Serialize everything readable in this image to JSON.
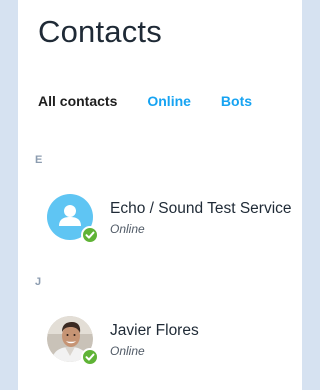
{
  "page": {
    "title": "Contacts"
  },
  "tabs": [
    {
      "label": "All contacts",
      "active": true
    },
    {
      "label": "Online",
      "active": false
    },
    {
      "label": "Bots",
      "active": false
    }
  ],
  "sections": [
    {
      "letter": "E",
      "contacts": [
        {
          "name": "Echo / Sound Test Service",
          "presence": "Online",
          "avatar_icon": "person-silhouette-icon"
        }
      ]
    },
    {
      "letter": "J",
      "contacts": [
        {
          "name": "Javier Flores",
          "presence": "Online",
          "avatar_icon": "profile-photo"
        }
      ]
    }
  ],
  "colors": {
    "background": "#d6e2f1",
    "accent": "#16a3f2",
    "online": "#5fb336",
    "avatar_default": "#5fc5f3"
  }
}
